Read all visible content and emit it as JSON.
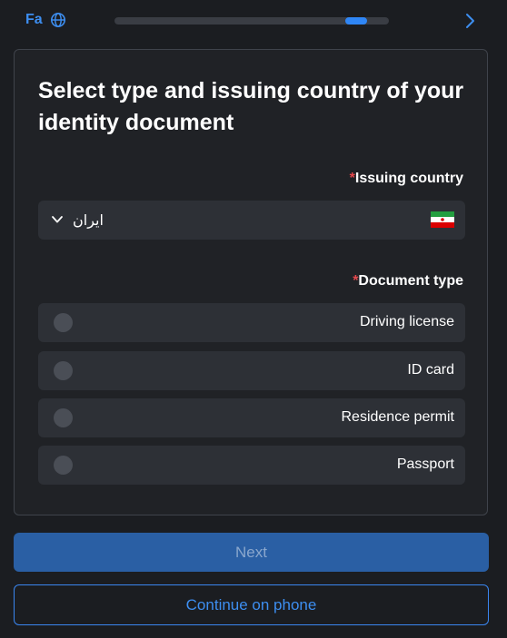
{
  "header": {
    "language_label": "Fa",
    "language_icon": "globe-icon",
    "progress": 0.92,
    "next_icon": "chevron-right-icon"
  },
  "form": {
    "title": "Select type and issuing country of your identity document",
    "required_marker": "*",
    "country": {
      "label": "Issuing country",
      "value": "ایران",
      "flag_icon": "iran-flag-icon"
    },
    "document_type": {
      "label": "Document type",
      "options": [
        {
          "label": "Driving license",
          "selected": false
        },
        {
          "label": "ID card",
          "selected": false
        },
        {
          "label": "Residence permit",
          "selected": false
        },
        {
          "label": "Passport",
          "selected": false
        }
      ]
    }
  },
  "actions": {
    "next_label": "Next",
    "phone_label": "Continue on phone"
  },
  "colors": {
    "accent": "#3d8ef0",
    "background": "#1b1d21",
    "card": "#202226",
    "field": "#2d3036",
    "required": "#e5484d",
    "disabled_button": "#2a5fa4"
  }
}
